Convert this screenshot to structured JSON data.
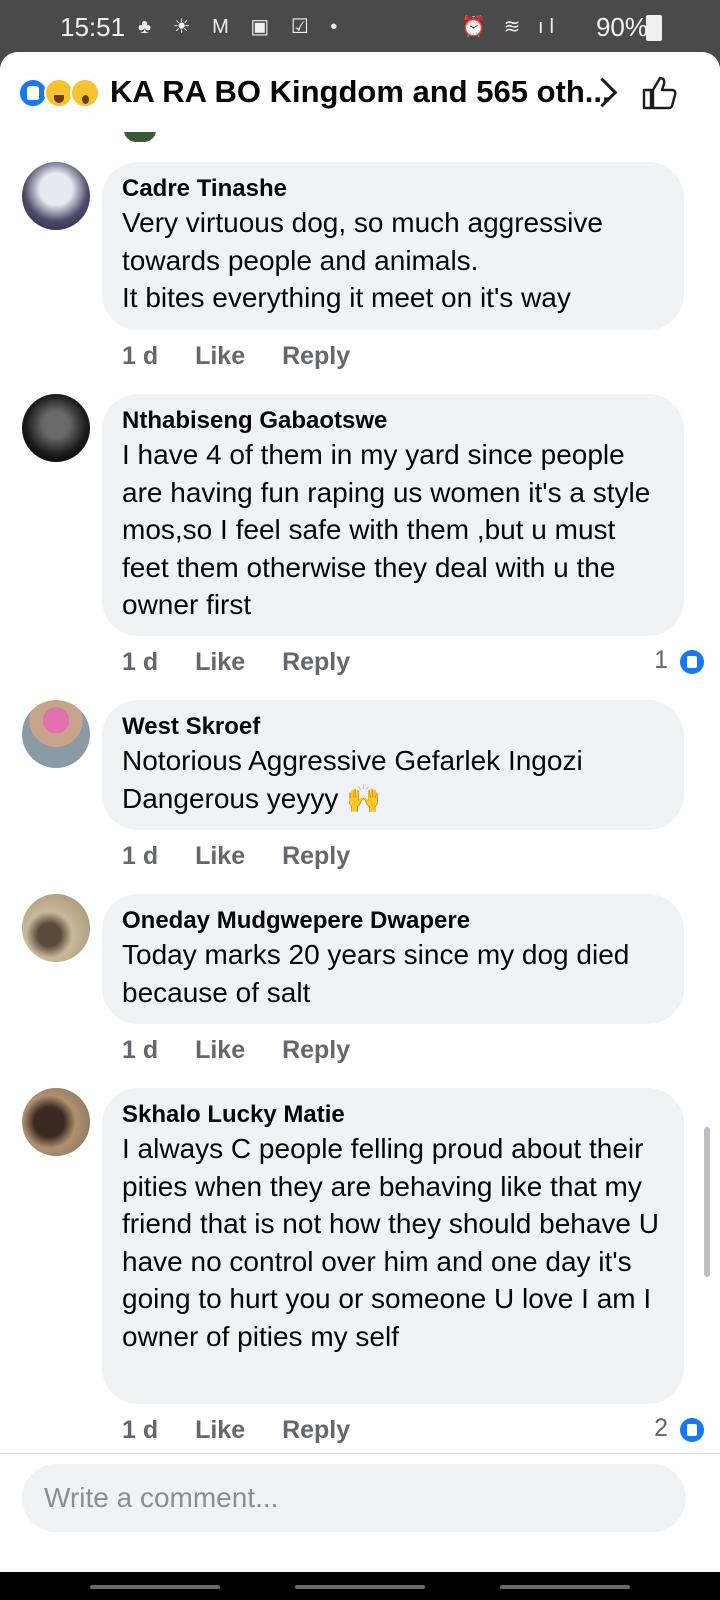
{
  "status_bar": {
    "time": "15:51",
    "battery": "90%",
    "left_icons": [
      "notification-icon",
      "weather-icon",
      "gmail-icon",
      "app-icon",
      "checkbox-icon",
      "dot-icon"
    ],
    "right_icons": [
      "alarm-icon",
      "wifi-icon",
      "signal-icon",
      "charging-icon"
    ]
  },
  "header": {
    "title": "KA RA BO Kingdom and 565 oth...",
    "reactions": [
      "like",
      "haha",
      "wow"
    ]
  },
  "comments": [
    {
      "author": "Cadre Tinashe",
      "text": "Very virtuous dog, so much aggressive towards people and animals.\nIt bites everything it meet on it's way",
      "time": "1 d",
      "like": "Like",
      "reply": "Reply",
      "reactions": ""
    },
    {
      "author": "Nthabiseng Gabaotswe",
      "text": "I have 4 of them in my yard since people are having fun raping us women it's a style mos,so I feel safe with them ,but u must feet them otherwise they deal with u the owner first",
      "time": "1 d",
      "like": "Like",
      "reply": "Reply",
      "reactions": "1"
    },
    {
      "author": "West Skroef",
      "text": "Notorious Aggressive Gefarlek Ingozi Dangerous yeyyy 🙌",
      "time": "1 d",
      "like": "Like",
      "reply": "Reply",
      "reactions": ""
    },
    {
      "author": "Oneday Mudgwepere Dwapere",
      "text": "Today marks 20 years since my dog died because of salt",
      "time": "1 d",
      "like": "Like",
      "reply": "Reply",
      "reactions": ""
    },
    {
      "author": "Skhalo Lucky Matie",
      "text": "I always C people felling proud about their pities when they are behaving like that my friend that is not how they should behave U have no control over him and one day it's going to hurt you or someone U love I am I owner of pities my self",
      "time": "1 d",
      "like": "Like",
      "reply": "Reply",
      "reactions": "2"
    }
  ],
  "composer": {
    "placeholder": "Write a comment..."
  },
  "colors": {
    "accent": "#1877f2",
    "bubble": "#f0f2f5",
    "meta_text": "#65676b"
  }
}
